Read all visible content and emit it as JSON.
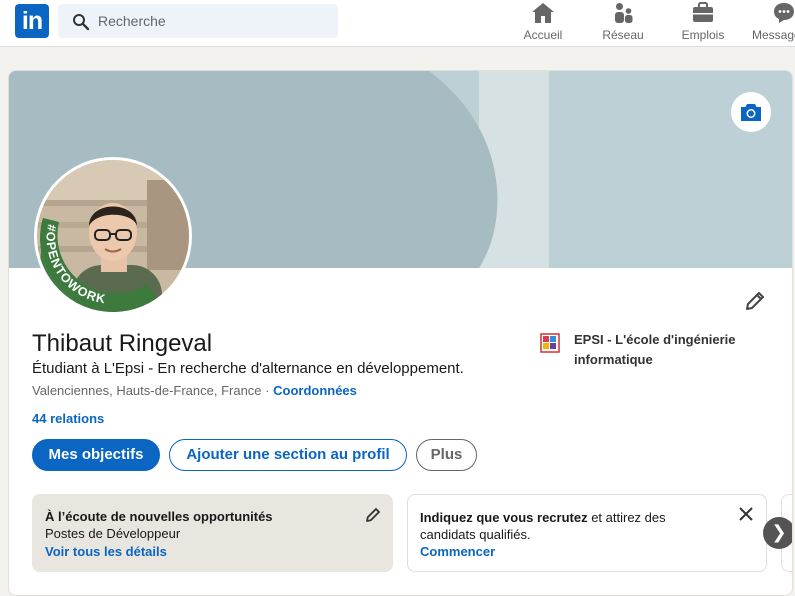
{
  "nav": {
    "logo_text": "in",
    "search_placeholder": "Recherche",
    "items": [
      {
        "label": "Accueil",
        "icon": "home-icon"
      },
      {
        "label": "Réseau",
        "icon": "network-icon"
      },
      {
        "label": "Emplois",
        "icon": "briefcase-icon"
      },
      {
        "label": "Messagerie",
        "icon": "messaging-icon"
      }
    ]
  },
  "profile": {
    "name": "Thibaut Ringeval",
    "headline": "Étudiant à L'Epsi - En recherche d'alternance en développement.",
    "location": "Valenciennes, Hauts-de-France, France ·",
    "contact_link": "Coordonnées",
    "relations": "44 relations",
    "open_to_work_badge": "#OPENTOWORK",
    "school": "EPSI - L'école d'ingénierie informatique"
  },
  "actions": {
    "goals": "Mes objectifs",
    "add_section": "Ajouter une section au profil",
    "more": "Plus"
  },
  "open_to_work_card": {
    "title": "À l’écoute de nouvelles opportunités",
    "roles": "Postes de Développeur",
    "details_link": "Voir tous les détails"
  },
  "hiring_card": {
    "text_bold": "Indiquez que vous recrutez",
    "text_rest": " et attirez des candidats qualifiés.",
    "cta": "Commencer"
  },
  "colors": {
    "brand": "#0a66c2",
    "open_to_work": "#3c7a3d",
    "banner": "#a7bcc2"
  }
}
